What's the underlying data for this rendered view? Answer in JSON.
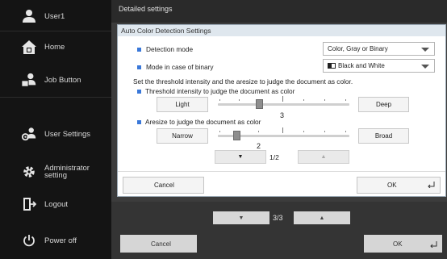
{
  "sidebar": {
    "items": [
      {
        "label": "User1",
        "icon": "user-icon"
      },
      {
        "label": "Home",
        "icon": "home-icon"
      },
      {
        "label": "Job Button",
        "icon": "job-button-icon"
      },
      {
        "label": "User Settings",
        "icon": "user-settings-icon"
      },
      {
        "label": "Administrator setting",
        "icon": "gear-icon"
      },
      {
        "label": "Logout",
        "icon": "logout-icon"
      },
      {
        "label": "Power off",
        "icon": "power-icon"
      }
    ]
  },
  "header": {
    "title": "Detailed settings"
  },
  "background": {
    "page_indicator": "3/3",
    "cancel_label": "Cancel",
    "ok_label": "OK"
  },
  "dialog": {
    "title": "Auto Color Detection Settings",
    "detection_mode": {
      "label": "Detection mode",
      "value": "Color, Gray or Binary"
    },
    "binary_mode": {
      "label": "Mode in case of binary",
      "value": "Black and White"
    },
    "instruction": "Set the threshold intensity and the aresize to judge the document as color.",
    "threshold": {
      "label": "Threshold intensity to judge the document as color",
      "left_button": "Light",
      "right_button": "Deep",
      "value": "3",
      "level": 3,
      "max": 5
    },
    "aresize": {
      "label": "Aresize to judge the document as color",
      "left_button": "Narrow",
      "right_button": "Broad",
      "value": "2",
      "level": 2,
      "max": 5
    },
    "page_indicator": "1/2",
    "cancel_label": "Cancel",
    "ok_label": "OK"
  },
  "colors": {
    "accent": "#3a78d9",
    "sidebar_bg": "#141414",
    "dialog_title_bg": "#dfe7ee"
  }
}
